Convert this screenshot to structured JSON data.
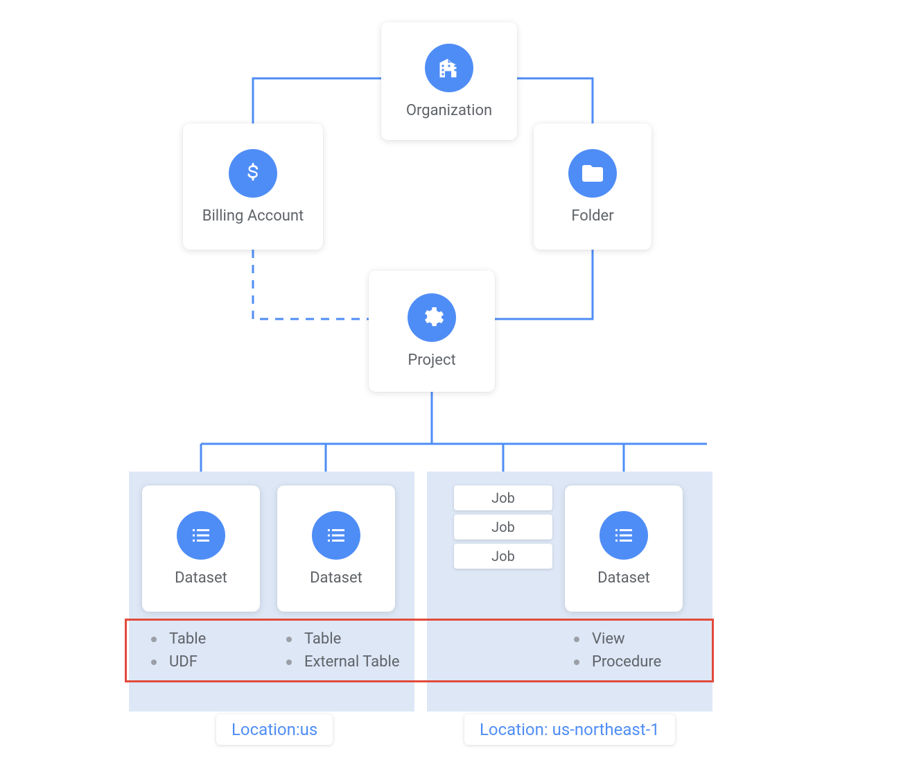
{
  "nodes": {
    "organization": {
      "label": "Organization"
    },
    "billing": {
      "label": "Billing Account"
    },
    "folder": {
      "label": "Folder"
    },
    "project": {
      "label": "Project"
    },
    "dataset1": {
      "label": "Dataset"
    },
    "dataset2": {
      "label": "Dataset"
    },
    "dataset3": {
      "label": "Dataset"
    }
  },
  "jobs": [
    "Job",
    "Job",
    "Job"
  ],
  "regions": {
    "left": {
      "location_label": "Location:us"
    },
    "right": {
      "location_label": "Location: us-northeast-1"
    }
  },
  "dataset_contents": {
    "ds1": [
      "Table",
      "UDF"
    ],
    "ds2": [
      "Table",
      "External Table"
    ],
    "ds3": [
      "View",
      "Procedure"
    ]
  },
  "edges": [
    {
      "from": "organization",
      "to": "billing",
      "style": "solid"
    },
    {
      "from": "organization",
      "to": "folder",
      "style": "solid"
    },
    {
      "from": "folder",
      "to": "project",
      "style": "solid"
    },
    {
      "from": "billing",
      "to": "project",
      "style": "dashed"
    },
    {
      "from": "project",
      "to": "dataset1",
      "style": "solid"
    },
    {
      "from": "project",
      "to": "dataset2",
      "style": "solid"
    },
    {
      "from": "project",
      "to": "jobs",
      "style": "solid"
    },
    {
      "from": "project",
      "to": "dataset3",
      "style": "solid"
    }
  ],
  "colors": {
    "accent": "#4f8df6",
    "region_bg": "#dde7f6",
    "text": "#5f6368",
    "highlight": "#e24a3b"
  }
}
